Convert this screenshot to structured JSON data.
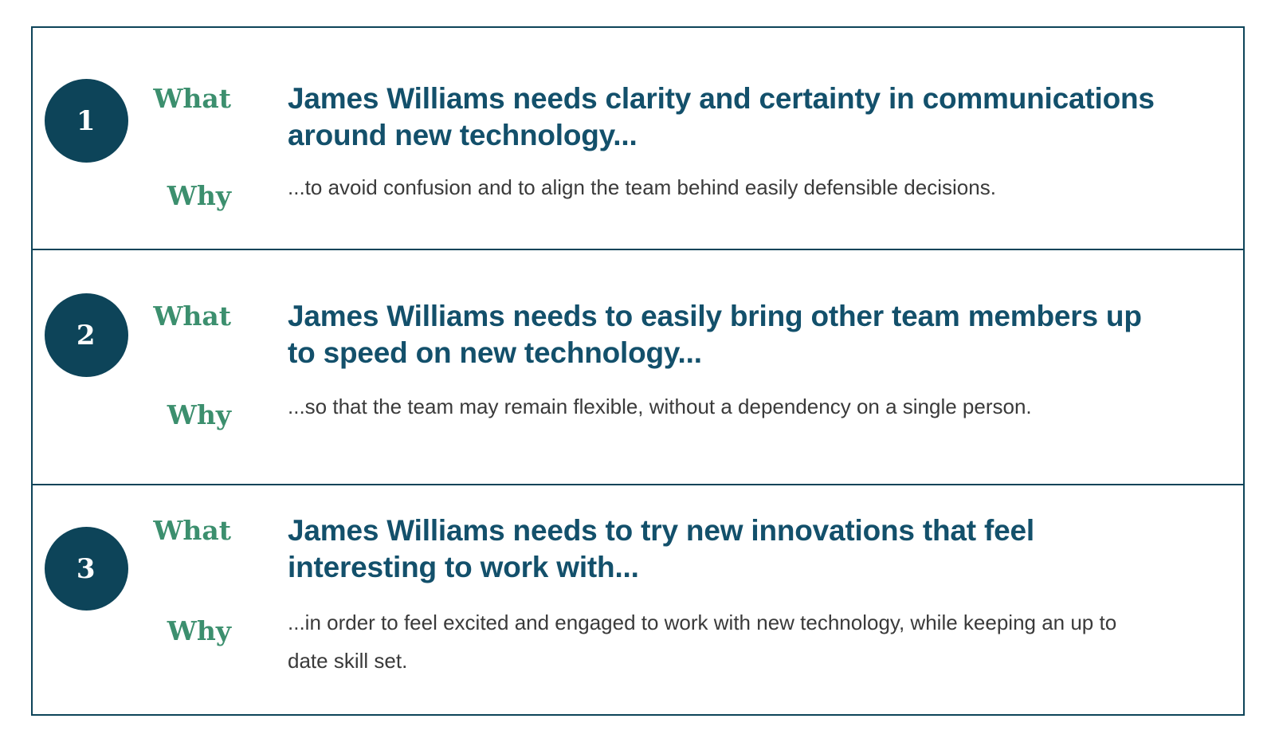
{
  "board": {
    "border_color": "#0d4459",
    "accent_circle_color": "#0d4459",
    "label_color": "#3c8f6e",
    "heading_color": "#13506b",
    "body_color": "#3a3a3a",
    "background_color": "#ffffff"
  },
  "labels": {
    "what": "What",
    "why": "Why"
  },
  "needs": [
    {
      "number": "1",
      "what_label": "What",
      "what": "James Williams needs clarity and certainty in communications around new technology...",
      "why_label": "Why",
      "why": "...to avoid confusion and to align the team behind easily defensible decisions."
    },
    {
      "number": "2",
      "what_label": "What",
      "what": "James Williams needs to easily bring other team members up to speed on new technology...",
      "why_label": "Why",
      "why": "...so that the team may remain flexible, without a dependency on a single person."
    },
    {
      "number": "3",
      "what_label": "What",
      "what": "James Williams needs to try new innovations that feel interesting to work with...",
      "why_label": "Why",
      "why": "...in order to feel excited and engaged to work with new technology, while keeping an up to date skill set."
    }
  ]
}
